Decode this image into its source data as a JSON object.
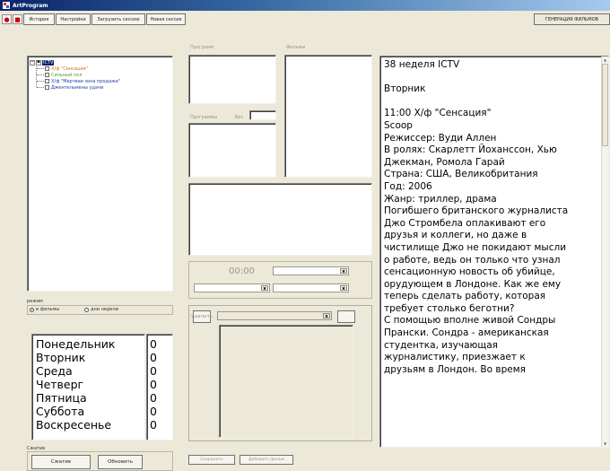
{
  "window": {
    "title": "ArtProgram"
  },
  "toolbar": {
    "buttons": [
      {
        "label": "История"
      },
      {
        "label": "Настройки"
      },
      {
        "label": "Загрузить сессию"
      },
      {
        "label": "Новая сессия"
      }
    ],
    "generate_label": "ГЕНЕРАЦИЯ ФИЛЬМОВ"
  },
  "tree": {
    "root": "ICTV",
    "items": [
      {
        "label": "Х/ф \"Сенсация\"",
        "color": "#c8701a"
      },
      {
        "label": "Сильный пол",
        "color": "#4c9a2a"
      },
      {
        "label": "Х/ф \"Мертвая зона продажи\"",
        "color": "#1c3fa8"
      },
      {
        "label": "Джентельмены удачи",
        "color": "#1c3fa8"
      }
    ]
  },
  "middle": {
    "label_left": "Программ",
    "label_right": "Фильмы",
    "label_time": "Программы",
    "label_small": "Вес",
    "time_value": "00:00",
    "button_left_label": "Удалить",
    "bottom_left_button": "Сохранить",
    "bottom_right_button": "Добавить фильм"
  },
  "mode": {
    "label": "режим",
    "option1": "и фильмы",
    "option2": "дни недели",
    "selected": "option1"
  },
  "days": [
    {
      "name": "Понедельник",
      "count": "0"
    },
    {
      "name": "Вторник",
      "count": "0"
    },
    {
      "name": "Среда",
      "count": "0"
    },
    {
      "name": "Четверг",
      "count": "0"
    },
    {
      "name": "Пятница",
      "count": "0"
    },
    {
      "name": "Суббота",
      "count": "0"
    },
    {
      "name": "Воскресенье",
      "count": "0"
    }
  ],
  "bottom": {
    "group_label": "Сжатие",
    "compress_button": "Сжатие",
    "refresh_button": "Обновить"
  },
  "text_panel": {
    "lines": [
      "38 неделя    ICTV",
      "",
      "Вторник",
      "",
      "11:00 Х/ф \"Сенсация\"",
      "Scoop",
      "Режиссер: Вуди Аллен",
      "В ролях: Скарлетт Йоханссон, Хью",
      "Джекман, Ромола Гарай",
      "Страна: США, Великобритания",
      "Год: 2006",
      "Жанр: триллер, драма",
      "Погибшего британского журналиста",
      "Джо Стромбела оплакивают его",
      "друзья и коллеги, но даже в",
      "чистилище Джо не покидают мысли",
      "о работе, ведь он только что узнал",
      "сенсационную новость об убийце,",
      "орудующем в Лондоне. Как же ему",
      "теперь сделать работу, которая",
      "требует столько беготни?",
      "С помощью вполне живой Сондры",
      "Прански. Сондра - американская",
      "студентка, изучающая",
      "журналистику, приезжает к",
      "друзьям в Лондон. Во время"
    ]
  },
  "colors": {
    "accent": "#0a246a",
    "window_bg": "#ece9d8"
  }
}
